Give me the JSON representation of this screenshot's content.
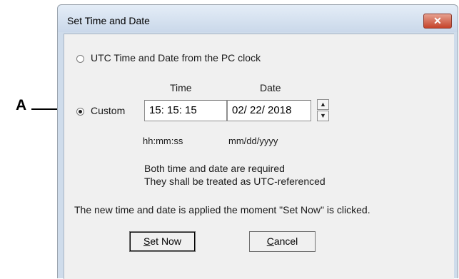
{
  "annotation": {
    "label": "A"
  },
  "dialog": {
    "title": "Set Time and Date",
    "close_glyph": "✕"
  },
  "options": {
    "utc_label": "UTC Time and Date from the PC clock",
    "custom_label": "Custom",
    "selected": "custom"
  },
  "fields": {
    "time_header": "Time",
    "date_header": "Date",
    "time_value": "15: 15: 15",
    "date_value": "02/ 22/ 2018",
    "time_format": "hh:mm:ss",
    "date_format": "mm/dd/yyyy"
  },
  "notes": {
    "line1": "Both time and date are required",
    "line2": "They shall be treated as UTC-referenced",
    "apply": "The new time and date is applied the moment  \"Set Now\" is clicked."
  },
  "buttons": {
    "set_now_mnemonic": "S",
    "set_now_rest": "et Now",
    "cancel_mnemonic": "C",
    "cancel_rest": "ancel"
  },
  "icons": {
    "spin_up": "▲",
    "spin_down": "▼"
  }
}
